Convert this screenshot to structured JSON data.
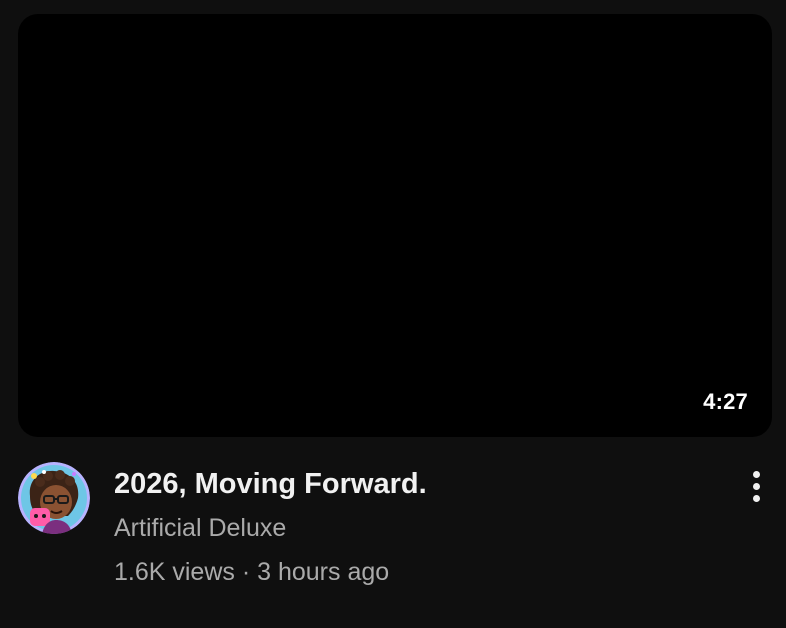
{
  "video": {
    "duration": "4:27",
    "title": "2026, Moving Forward.",
    "channel": "Artificial Deluxe",
    "views": "1.6K views",
    "separator": "·",
    "age": "3 hours ago"
  },
  "icons": {
    "avatar": "channel-avatar-illustration",
    "menu": "more-vert-icon"
  },
  "colors": {
    "background": "#0f0f0f",
    "thumbnail": "#000000",
    "title_text": "#f1f1f1",
    "secondary_text": "#aaaaaa",
    "avatar_ring": "#b7b3ff"
  }
}
